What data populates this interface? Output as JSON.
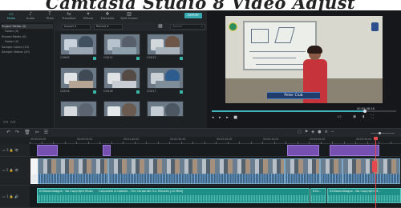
{
  "page_caption": "Camtasia Studio 8 Video Adjust",
  "toolbar": {
    "items": [
      {
        "label": "Media",
        "icon": "folder-icon",
        "glyph": "▭"
      },
      {
        "label": "Audio",
        "icon": "music-note-icon",
        "glyph": "♪"
      },
      {
        "label": "Titles",
        "icon": "text-icon",
        "glyph": "T"
      },
      {
        "label": "Transition",
        "icon": "transition-icon",
        "glyph": "⇆"
      },
      {
        "label": "Effects",
        "icon": "effects-icon",
        "glyph": "✦"
      },
      {
        "label": "Elements",
        "icon": "elements-icon",
        "glyph": "❖"
      },
      {
        "label": "Split Screen",
        "icon": "split-screen-icon",
        "glyph": "▥"
      }
    ],
    "export_label": "EXPORT"
  },
  "library": {
    "folders": [
      "Project Media (0)",
      "Folder (0)",
      "Shared Media (0)",
      "Folder (0)",
      "Sample Colors (15)",
      "Sample Videos (20)"
    ],
    "import_label": "Import",
    "sort_label": "Recent",
    "search_placeholder": "Search",
    "media": [
      "C0005",
      "C0011",
      "C0012",
      "C0014",
      "C0016",
      "C0017",
      "",
      "",
      ""
    ]
  },
  "preview": {
    "overlay_title": "Peter Club",
    "timecode": "00:05:48:16",
    "ratio_label": "1/2",
    "controls": "◂ ▸ ▸ ■",
    "progress": 0.83
  },
  "timeline": {
    "ruler": [
      "00:00:00:00",
      "00:00:50:00",
      "00:01:40:00",
      "00:02:30:00",
      "00:03:20:00",
      "00:04:10:00",
      "00:05:00:00",
      "00:05:50:00"
    ],
    "tracks": [
      {
        "id": "3",
        "type": "effects"
      },
      {
        "id": "2",
        "type": "video"
      },
      {
        "id": "1",
        "type": "audio"
      }
    ],
    "audio_clip_text": "K33lowndaagpe - No Copyright Music  🎵  Corporate & Upbeat - The Corporate 3-4 Minutes [10 Mbit]",
    "audio_clip2_text": "K33...",
    "audio_clip3_text": "K33lowndaagpe - No Copyright M..."
  },
  "colors": {
    "accent": "#39a9b1",
    "effects_clip": "#7550b0",
    "audio_clip": "#1f8e86",
    "playhead": "#e5484d"
  }
}
